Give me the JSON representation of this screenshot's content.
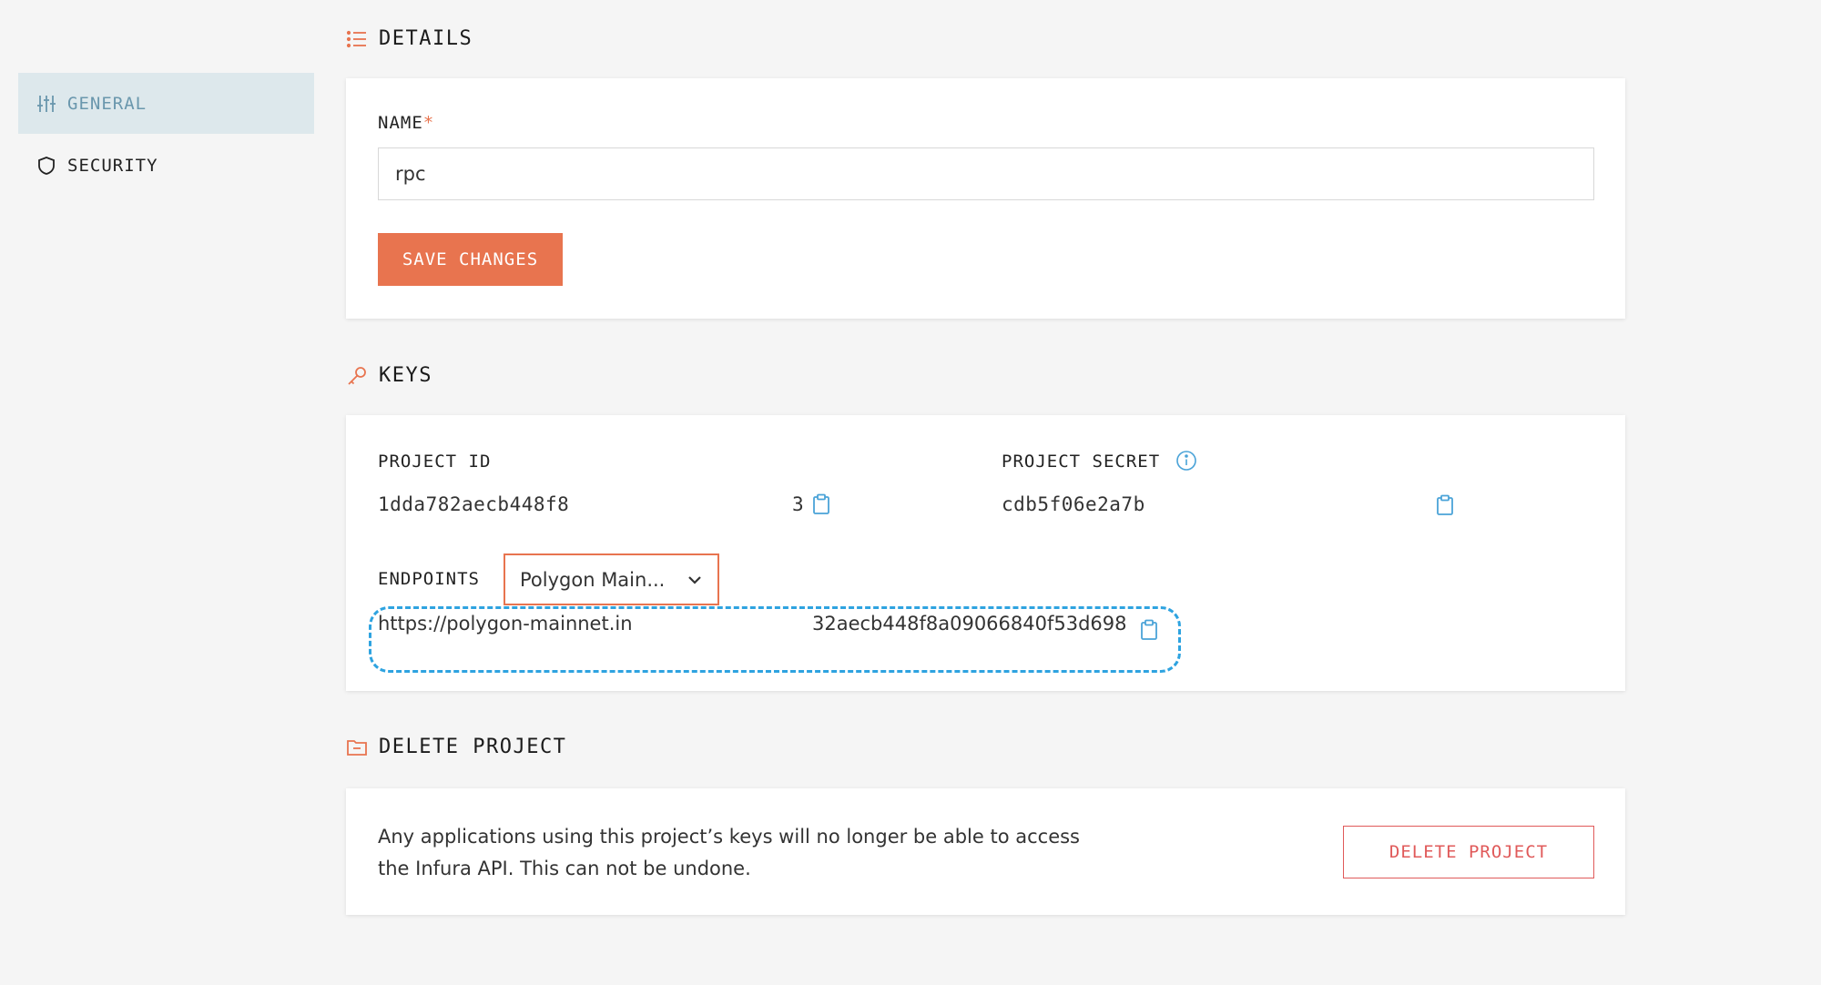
{
  "sidebar": {
    "items": [
      {
        "label": "GENERAL",
        "icon": "sliders-icon",
        "active": true
      },
      {
        "label": "SECURITY",
        "icon": "shield-icon",
        "active": false
      }
    ]
  },
  "details": {
    "heading": "DETAILS",
    "name_label": "NAME",
    "required_mark": "*",
    "name_value": "rpc",
    "save_label": "SAVE CHANGES"
  },
  "keys": {
    "heading": "KEYS",
    "project_id_label": "PROJECT ID",
    "project_id_value_start": "1dda782aecb448f8",
    "project_id_value_end": "3",
    "project_secret_label": "PROJECT SECRET",
    "project_secret_value": "cdb5f06e2a7b",
    "endpoints_label": "ENDPOINTS",
    "endpoint_network": "Polygon Main...",
    "endpoint_url_start": "https://polygon-mainnet.in",
    "endpoint_url_end": "32aecb448f8a09066840f53d698"
  },
  "delete_project": {
    "heading": "DELETE PROJECT",
    "description_line1": "Any applications using this project’s keys will no longer be able to access",
    "description_line2": "the Infura API. This can not be undone.",
    "button_label": "DELETE PROJECT"
  },
  "colors": {
    "accent": "#e8744f",
    "active_nav_bg": "#dde8ec",
    "active_nav_text": "#6a97ad",
    "danger": "#e05a5a",
    "highlight_ring": "#2ea3e0"
  }
}
